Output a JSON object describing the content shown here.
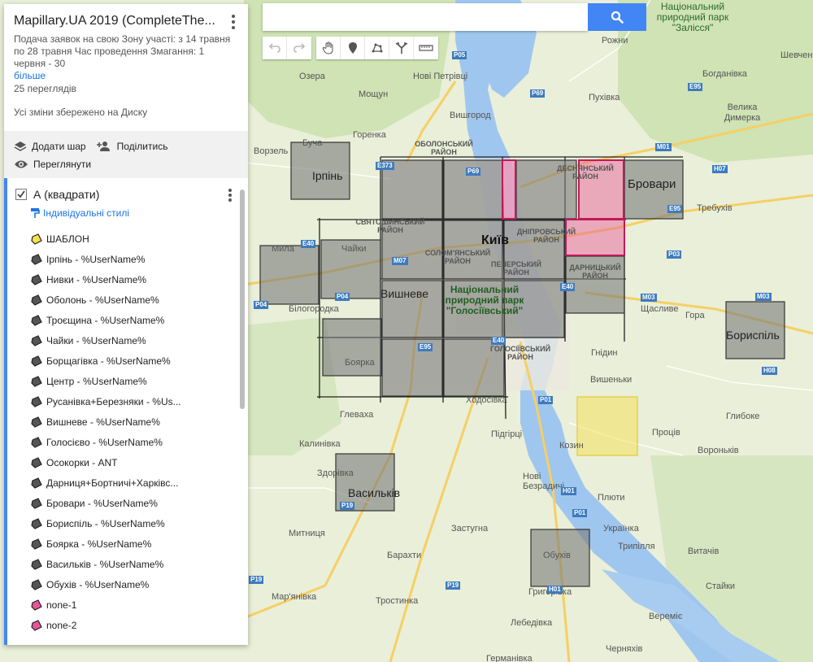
{
  "search": {
    "placeholder": "",
    "button_icon": "search-icon"
  },
  "toolbar": {
    "tools": [
      "undo-icon",
      "redo-icon",
      "hand-icon",
      "marker-icon",
      "polygon-icon",
      "directions-icon",
      "ruler-icon"
    ]
  },
  "sidebar": {
    "title": "Mapillary.UA 2019 (CompleteThe...",
    "description": "Подача заявок на свою Зону участі: з 14 травня по 28 травня Час проведення Змагання: 1 червня - 30",
    "more": "більше",
    "views": "25 переглядів",
    "saved": "Усі зміни збережено на Диску",
    "actions": {
      "add_layer": "Додати шар",
      "share": "Поділитись",
      "preview": "Переглянути"
    },
    "layer": {
      "name": "А (квадрати)",
      "styles": "Індивідуальні стилі",
      "features": [
        {
          "label": "ШАБЛОН",
          "color": "#f5e04e"
        },
        {
          "label": "Ірпінь - %UserName%",
          "color": "#555555"
        },
        {
          "label": "Нивки - %UserName%",
          "color": "#555555"
        },
        {
          "label": "Оболонь - %UserName%",
          "color": "#555555"
        },
        {
          "label": "Троєщина - %UserName%",
          "color": "#555555"
        },
        {
          "label": "Чайки - %UserName%",
          "color": "#555555"
        },
        {
          "label": "Борщагівка - %UserName%",
          "color": "#555555"
        },
        {
          "label": "Центр - %UserName%",
          "color": "#555555"
        },
        {
          "label": "Русанівка+Березняки - %Us...",
          "color": "#555555"
        },
        {
          "label": "Вишневе - %UserName%",
          "color": "#555555"
        },
        {
          "label": "Голосієво - %UserName%",
          "color": "#555555"
        },
        {
          "label": "Осокорки - ANT",
          "color": "#555555"
        },
        {
          "label": "Дарниця+Бортничі+Харківс...",
          "color": "#555555"
        },
        {
          "label": "Бровари - %UserName%",
          "color": "#555555"
        },
        {
          "label": "Бориспіль - %UserName%",
          "color": "#555555"
        },
        {
          "label": "Боярка - %UserName%",
          "color": "#555555"
        },
        {
          "label": "Васильків - %UserName%",
          "color": "#555555"
        },
        {
          "label": "Обухів - %UserName%",
          "color": "#555555"
        },
        {
          "label": "none-1",
          "color": "#e8559a"
        },
        {
          "label": "none-2",
          "color": "#e8559a"
        }
      ]
    }
  },
  "map": {
    "labels": {
      "ozera": "Озера",
      "novi_petrivtsi": "Нові Петрівці",
      "moshchun": "Мощун",
      "vyshhorod": "Вишгород",
      "horenka": "Горенка",
      "vorzel": "Ворзель",
      "bucha": "Буча",
      "irpin": "Ірпінь",
      "obolonskyi": "ОБОЛОНСЬКИЙ РАЙОН",
      "desnianskyi": "ДЕСНЯНСЬКИЙ РАЙОН",
      "brovary": "Бровари",
      "svyatoshynskyi": "СВЯТОШИНСЬКИЙ РАЙОН",
      "kyiv": "Київ",
      "dniprovskyi": "ДНІПРОВСЬКИЙ РАЙОН",
      "myla": "Мила",
      "chaiky": "Чайки",
      "solomianskyi": "СОЛОМ'ЯНСЬКИЙ РАЙОН",
      "pecherskyi": "ПЕЧЕРСЬКИЙ РАЙОН",
      "darnytskyi": "ДАРНИЦЬКИЙ РАЙОН",
      "vyshneve": "Вишневе",
      "park_holosiivskyi": "Національний природний парк \"Голосіївський\"",
      "bilohorodka": "Білогородка",
      "shchaslyve": "Щасливе",
      "hora": "Гора",
      "boryspil": "Бориспіль",
      "holosiivskyi": "ГОЛОСІЇВСЬКИЙ РАЙОН",
      "hnidyn": "Гнідин",
      "boiarka": "Боярка",
      "vyshenky": "Вишеньки",
      "khodosivka": "Ходосівка",
      "hlevakha": "Глеваха",
      "pidhirtsi": "Підгірці",
      "hlyboke": "Глибоке",
      "kalynivka": "Калинівка",
      "kozyn": "Козин",
      "protsiv": "Проців",
      "voronkiv": "Вороньків",
      "zdorivka": "Здорівка",
      "vasylkiv": "Васильків",
      "novi_bezradychi": "Нові Безрадичі",
      "plyuty": "Плюти",
      "mytnytsia": "Митниця",
      "zastuhna": "Застугна",
      "ukrainka": "Українка",
      "trypillia": "Трипілля",
      "obukhiv": "Обухів",
      "barakhty": "Барахти",
      "vytachiv": "Витачів",
      "maryanivka": "Мар'янівка",
      "trostynka": "Тростинка",
      "stayky": "Стайки",
      "hryhorivka": "Григорівка",
      "vereshchaky": "Вереміє",
      "lebedivka": "Лебедівка",
      "cherniakhiv": "Черняхів",
      "germanivka": "Германівка",
      "rozhny": "Рожни",
      "pukhivka": "Пухівка",
      "shevchenkove": "Шевчен",
      "bohdanivka": "Богданівка",
      "velyka_dymerka": "Велика Димерка",
      "trebukhiv": "Требухів",
      "park_zalissia": "Національний природний парк \"Залісся\"",
      "velyka_dymerka_top": "Велика"
    },
    "shields": {
      "e95_top": "E95",
      "p69_top": "P69",
      "m01": "M01",
      "h07": "H07",
      "e373": "E373",
      "p69": "P69",
      "e95_brovary": "E95",
      "e40": "E40",
      "m07": "M07",
      "p04": "P04",
      "p04b": "P04",
      "e40b": "E40",
      "p03": "P03",
      "m03": "M03",
      "m03b": "M03",
      "h08": "H08",
      "e95_south": "E95",
      "e40_south": "E40",
      "p01": "P01",
      "h01": "H01",
      "p01b": "P01",
      "p19": "P19",
      "p19b": "P19",
      "p19c": "P19",
      "h01b": "H01",
      "p05": "P05"
    }
  }
}
